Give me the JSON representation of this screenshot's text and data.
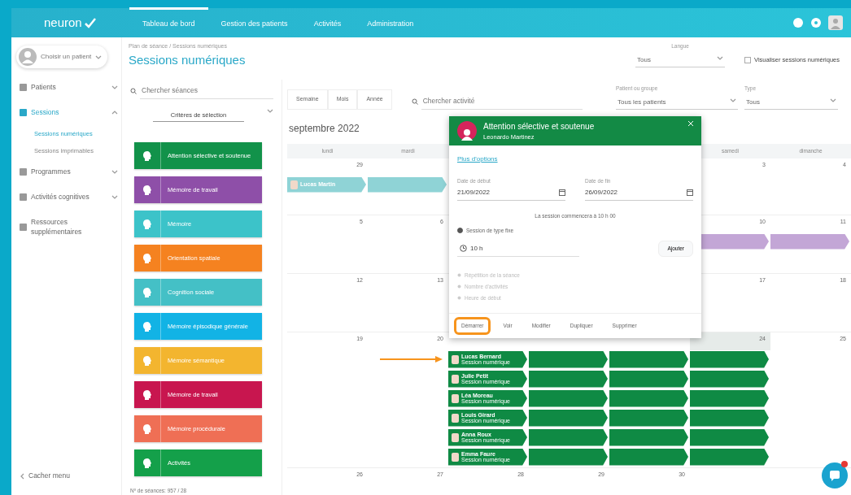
{
  "app": {
    "logo": "neuron"
  },
  "nav": [
    {
      "label": "Tableau de bord",
      "selected": true
    },
    {
      "label": "Gestion des patients",
      "selected": false
    },
    {
      "label": "Activités",
      "selected": false
    },
    {
      "label": "Administration",
      "selected": false
    }
  ],
  "user": {
    "label": "Choisir un patient"
  },
  "sidebar": {
    "items": [
      {
        "label": "Patients",
        "expanded": false,
        "selected": false
      },
      {
        "label": "Sessions",
        "expanded": true,
        "selected": true,
        "children": [
          {
            "label": "Sessions numériques",
            "selected": true
          },
          {
            "label": "Sessions imprimables",
            "selected": false
          }
        ]
      },
      {
        "label": "Programmes",
        "expanded": false,
        "selected": false
      },
      {
        "label": "Activités cognitives",
        "expanded": false,
        "selected": false
      },
      {
        "label": "Ressources supplémentaires",
        "selected": false
      }
    ],
    "hide_menu": "Cacher menu"
  },
  "header": {
    "breadcrumb": "Plan de séance / Sessions numériques",
    "title": "Sessions numériques",
    "language": {
      "label": "Langue",
      "value": "Tous"
    },
    "checkbox": {
      "label": "Visualiser sessions numériques",
      "checked": false
    }
  },
  "activities": {
    "search": {
      "placeholder": "Chercher séances"
    },
    "criteria": "Critères de sélection",
    "categories": [
      {
        "label": "Attention sélective et soutenue",
        "color": "#12924a"
      },
      {
        "label": "Mémoire de travail",
        "color": "#8e4fa8"
      },
      {
        "label": "Mémoire",
        "color": "#3cc3c9"
      },
      {
        "label": "Orientation spatiale",
        "color": "#f58220"
      },
      {
        "label": "Cognition sociale",
        "color": "#44c0c6"
      },
      {
        "label": "Mémoire épisodique générale",
        "color": "#12b3e5"
      },
      {
        "label": "Mémoire sémantique",
        "color": "#f3b52f"
      },
      {
        "label": "Mémoire de travail",
        "color": "#c8164f"
      },
      {
        "label": "Mémoire procédurale",
        "color": "#ef6f55"
      },
      {
        "label": "Activités",
        "color": "#14a04a"
      }
    ],
    "count": "Nº de séances: 957 / 28"
  },
  "calendar": {
    "views": [
      "Semaine",
      "Mois",
      "Année"
    ],
    "search": {
      "placeholder": "Chercher activité"
    },
    "filters": [
      {
        "label": "Patient ou groupe",
        "value": "Tous les patients"
      },
      {
        "label": "Type",
        "value": "Tous"
      }
    ],
    "month": "septembre 2022",
    "weekdays": {
      "mon": "lundi",
      "tue": "mardi",
      "sat": "samedi",
      "sun": "dimanche"
    },
    "weeks": [
      {
        "days": {
          "mon": {
            "label": "29",
            "today": false
          },
          "sat": {
            "label": "3",
            "today": false
          },
          "sun": {
            "label": "4",
            "today": false
          }
        },
        "events": [
          {
            "color": "#8fd3d6",
            "label": "Lucas Martin"
          }
        ]
      },
      {
        "days": {
          "mon": {
            "label": "5",
            "today": false
          },
          "tue": {
            "label": "6",
            "today": false
          },
          "sat": {
            "label": "10",
            "today": false
          },
          "sun": {
            "label": "11",
            "today": false
          }
        },
        "events": [
          {
            "color": "#c3a6d6"
          }
        ]
      },
      {
        "days": {
          "mon": {
            "label": "12",
            "today": false
          },
          "tue": {
            "label": "13",
            "today": false
          },
          "sat": {
            "label": "17",
            "today": false
          },
          "sun": {
            "label": "18",
            "today": false
          }
        }
      },
      {
        "days": {
          "mon": {
            "label": "19",
            "today": false
          },
          "tue": {
            "label": "20",
            "today": false
          },
          "sat": {
            "label": "24",
            "today": true
          },
          "sun": {
            "label": "25",
            "today": false
          }
        },
        "events": [
          {
            "color": "#0f8a44",
            "label": "Lucas Bernard",
            "sub": "Session numérique",
            "arrow": true
          },
          {
            "color": "#0f8a44",
            "label": "Julie Petit",
            "sub": "Session numérique"
          },
          {
            "color": "#0f8a44",
            "label": "Léa Moreau",
            "sub": "Session numérique"
          },
          {
            "color": "#0f8a44",
            "label": "Louis Girard",
            "sub": "Session numérique"
          },
          {
            "color": "#0f8a44",
            "label": "Anna Roux",
            "sub": "Session numérique"
          },
          {
            "color": "#0f8a44",
            "label": "Emma Faure",
            "sub": "Session numérique"
          }
        ]
      },
      {
        "days": {
          "mon": {
            "label": "26",
            "today": false
          },
          "tue": {
            "label": "27",
            "today": false
          },
          "wed": {
            "label": "28",
            "today": false
          },
          "thu": {
            "label": "29",
            "today": false
          },
          "fri": {
            "label": "30",
            "today": false
          }
        }
      }
    ]
  },
  "popup": {
    "title": "Attention sélective et soutenue",
    "subtitle": "Leonardo Martinez",
    "link": "Plus d'options",
    "start": {
      "label": "Date de début",
      "value": "21/09/2022"
    },
    "end": {
      "label": "Date de fin",
      "value": "26/09/2022"
    },
    "info": "La session commencera à 10 h 00",
    "radio": {
      "label": "Session de type fixe",
      "checked": true
    },
    "duration": "10 h",
    "add": "Ajouter",
    "options": [
      "Répétition de la séance",
      "Nombre d'activités",
      "Heure de début"
    ],
    "actions": [
      {
        "label": "Démarrer",
        "highlighted": true
      },
      {
        "label": "Voir",
        "highlighted": false
      },
      {
        "label": "Modifier",
        "highlighted": false
      },
      {
        "label": "Dupliquer",
        "highlighted": false
      },
      {
        "label": "Supprimer",
        "highlighted": false
      }
    ]
  },
  "chat": {
    "unread": true
  }
}
